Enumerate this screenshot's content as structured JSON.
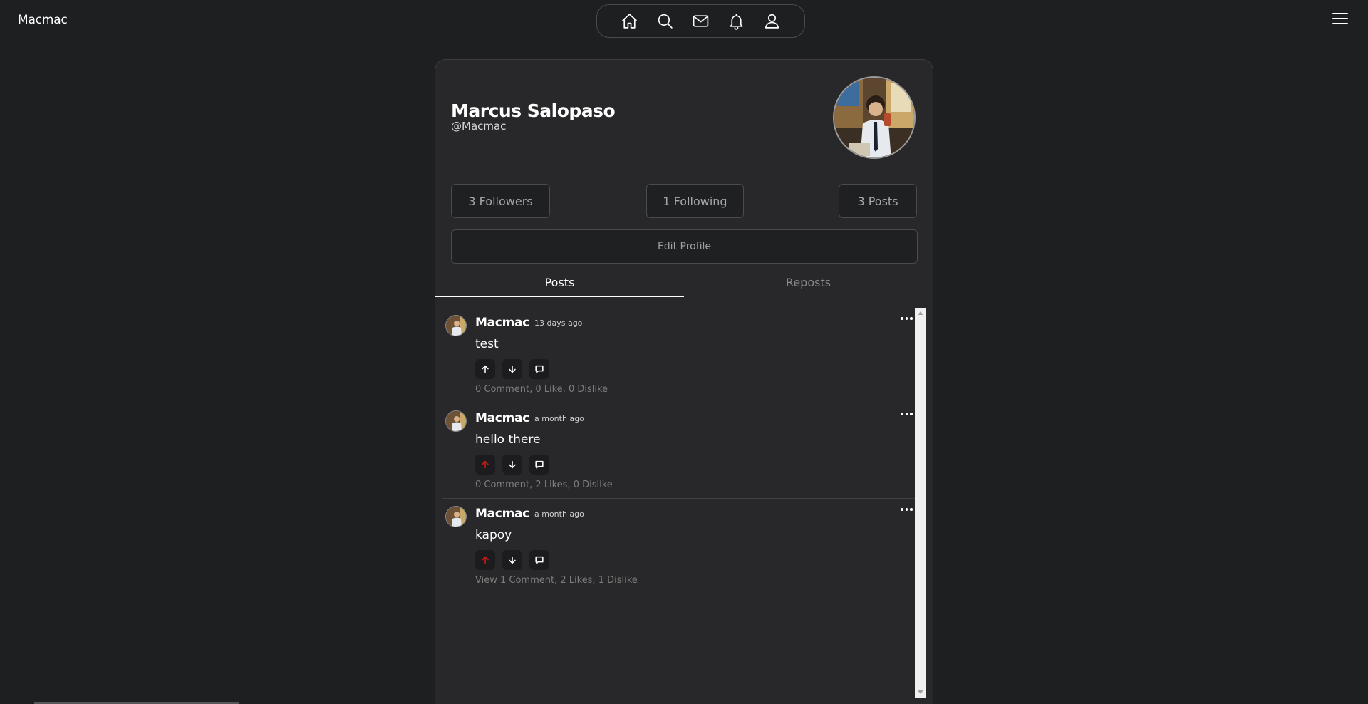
{
  "header": {
    "brand": "Macmac",
    "nav_icons": [
      "home-icon",
      "search-icon",
      "mail-icon",
      "bell-icon",
      "user-icon"
    ],
    "menu_icon": "hamburger-menu-icon"
  },
  "profile": {
    "name": "Marcus Salopaso",
    "handle": "@Macmac",
    "followers_label": "3 Followers",
    "following_label": "1 Following",
    "posts_label": "3 Posts",
    "edit_label": "Edit Profile"
  },
  "tabs": {
    "posts": "Posts",
    "reposts": "Reposts",
    "active": "Posts"
  },
  "posts": [
    {
      "user": "Macmac",
      "time": "13 days ago",
      "text": "test",
      "upvoted": false,
      "stats_label": "0 Comment,  0 Like, 0 Dislike"
    },
    {
      "user": "Macmac",
      "time": "a month ago",
      "text": "hello there",
      "upvoted": true,
      "stats_label": "0 Comment,  2 Likes, 0 Dislike"
    },
    {
      "user": "Macmac",
      "time": "a month ago",
      "text": "kapoy",
      "upvoted": true,
      "stats_label": "View 1 Comment,  2 Likes, 1 Dislike"
    }
  ],
  "colors": {
    "background": "#1e1f21",
    "card": "#28282a",
    "upvote_active": "#d11a1a",
    "text_muted": "#7d7d7d"
  }
}
